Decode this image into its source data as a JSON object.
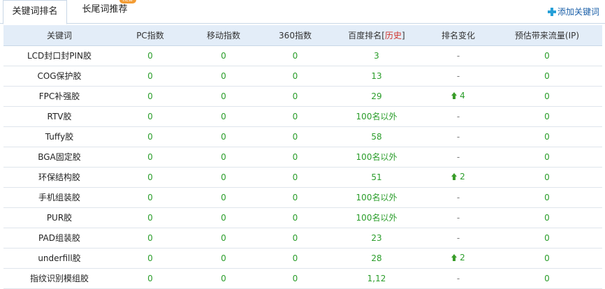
{
  "tabs": [
    {
      "label": "关键词排名"
    },
    {
      "label": "长尾词推荐"
    }
  ],
  "new_badge": "new",
  "add_keyword": "添加关键词",
  "columns": [
    "关键词",
    "PC指数",
    "移动指数",
    "360指数",
    "百度排名[",
    "历史",
    "]",
    "排名变化",
    "预估带来流量(IP)"
  ],
  "rows": [
    {
      "keyword": "LCD封口封PIN胶",
      "pc": "0",
      "mobile": "0",
      "s360": "0",
      "rank": "3",
      "change": "-",
      "flow": "0"
    },
    {
      "keyword": "COG保护胶",
      "pc": "0",
      "mobile": "0",
      "s360": "0",
      "rank": "13",
      "change": "-",
      "flow": "0"
    },
    {
      "keyword": "FPC补强胶",
      "pc": "0",
      "mobile": "0",
      "s360": "0",
      "rank": "29",
      "change": "4",
      "flow": "0"
    },
    {
      "keyword": "RTV胶",
      "pc": "0",
      "mobile": "0",
      "s360": "0",
      "rank": "100名以外",
      "change": "-",
      "flow": "0"
    },
    {
      "keyword": "Tuffy胶",
      "pc": "0",
      "mobile": "0",
      "s360": "0",
      "rank": "58",
      "change": "-",
      "flow": "0"
    },
    {
      "keyword": "BGA固定胶",
      "pc": "0",
      "mobile": "0",
      "s360": "0",
      "rank": "100名以外",
      "change": "-",
      "flow": "0"
    },
    {
      "keyword": "环保结构胶",
      "pc": "0",
      "mobile": "0",
      "s360": "0",
      "rank": "51",
      "change": "2",
      "flow": "0"
    },
    {
      "keyword": "手机组装胶",
      "pc": "0",
      "mobile": "0",
      "s360": "0",
      "rank": "100名以外",
      "change": "-",
      "flow": "0"
    },
    {
      "keyword": "PUR胶",
      "pc": "0",
      "mobile": "0",
      "s360": "0",
      "rank": "100名以外",
      "change": "-",
      "flow": "0"
    },
    {
      "keyword": "PAD组装胶",
      "pc": "0",
      "mobile": "0",
      "s360": "0",
      "rank": "23",
      "change": "-",
      "flow": "0"
    },
    {
      "keyword": "underfill胶",
      "pc": "0",
      "mobile": "0",
      "s360": "0",
      "rank": "28",
      "change": "2",
      "flow": "0"
    },
    {
      "keyword": "指纹识别模组胶",
      "pc": "0",
      "mobile": "0",
      "s360": "0",
      "rank": "1,12",
      "change": "-",
      "flow": "0"
    }
  ]
}
